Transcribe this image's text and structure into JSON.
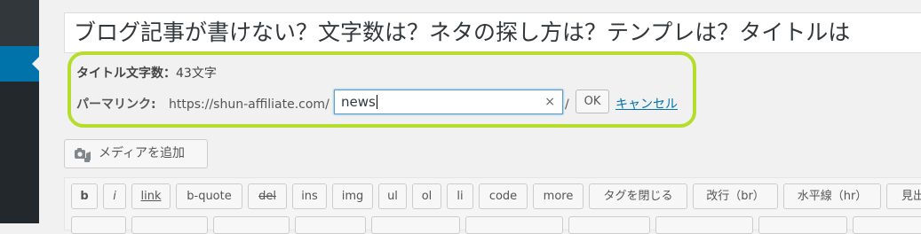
{
  "title": {
    "value": "ブログ記事が書けない？文字数は？ネタの探し方は？テンプレは？タイトルは"
  },
  "title_count": {
    "label": "タイトル文字数：",
    "value": "43文字"
  },
  "permalink": {
    "label": "パーマリンク:",
    "base_url": "https://shun-affiliate.com/",
    "slug_value": "news",
    "clear_glyph": "×",
    "trailing_slash": "/",
    "ok_label": "OK",
    "cancel_label": "キャンセル"
  },
  "media": {
    "button_label": "メディアを追加",
    "icon": "media-camera-icon"
  },
  "quicktags": [
    {
      "label": "b",
      "style": "b"
    },
    {
      "label": "i",
      "style": "i"
    },
    {
      "label": "link",
      "style": "link"
    },
    {
      "label": "b-quote",
      "style": ""
    },
    {
      "label": "del",
      "style": "del"
    },
    {
      "label": "ins",
      "style": ""
    },
    {
      "label": "img",
      "style": ""
    },
    {
      "label": "ul",
      "style": ""
    },
    {
      "label": "ol",
      "style": ""
    },
    {
      "label": "li",
      "style": ""
    },
    {
      "label": "code",
      "style": ""
    },
    {
      "label": "more",
      "style": ""
    },
    {
      "label": "タグを閉じる",
      "style": ""
    },
    {
      "label": "改行（br）",
      "style": ""
    },
    {
      "label": "水平線（hr）",
      "style": ""
    },
    {
      "label": "見出",
      "style": ""
    }
  ],
  "colors": {
    "sidebar": "#23282d",
    "sidebar_active": "#0073aa",
    "highlight": "#b6dd2b",
    "link": "#0073aa"
  }
}
